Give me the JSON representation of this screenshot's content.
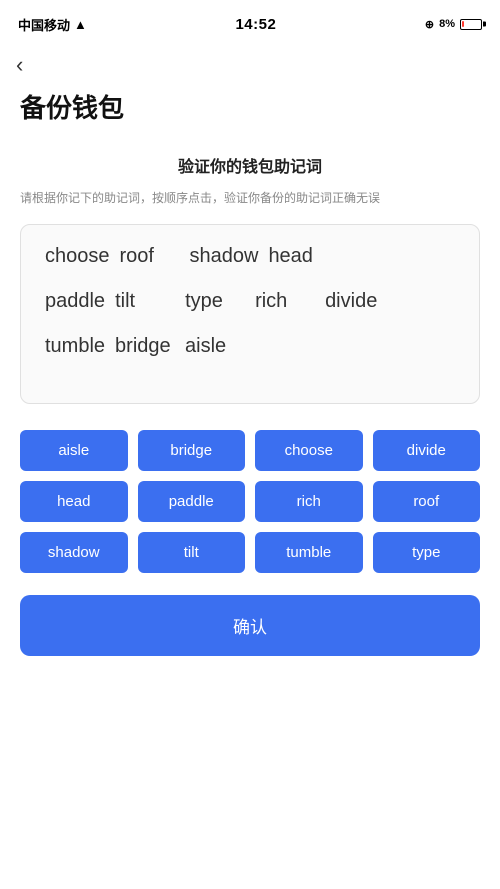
{
  "statusBar": {
    "carrier": "中国移动",
    "time": "14:52",
    "batteryPercent": "8%"
  },
  "backButton": "‹",
  "pageTitle": "备份钱包",
  "section": {
    "title": "验证你的钱包助记词",
    "desc": "请根据你记下的助记词，按顺序点击，验证你备份的助记词正确无误"
  },
  "displayWords": [
    [
      "choose",
      "roof",
      "shadow",
      "head"
    ],
    [
      "paddle",
      "tilt",
      "type",
      "rich",
      "divide"
    ],
    [
      "tumble",
      "bridge",
      "aisle"
    ]
  ],
  "selectableWords": [
    "aisle",
    "bridge",
    "choose",
    "divide",
    "head",
    "paddle",
    "rich",
    "roof",
    "shadow",
    "tilt",
    "tumble",
    "type"
  ],
  "confirmButton": "确认"
}
